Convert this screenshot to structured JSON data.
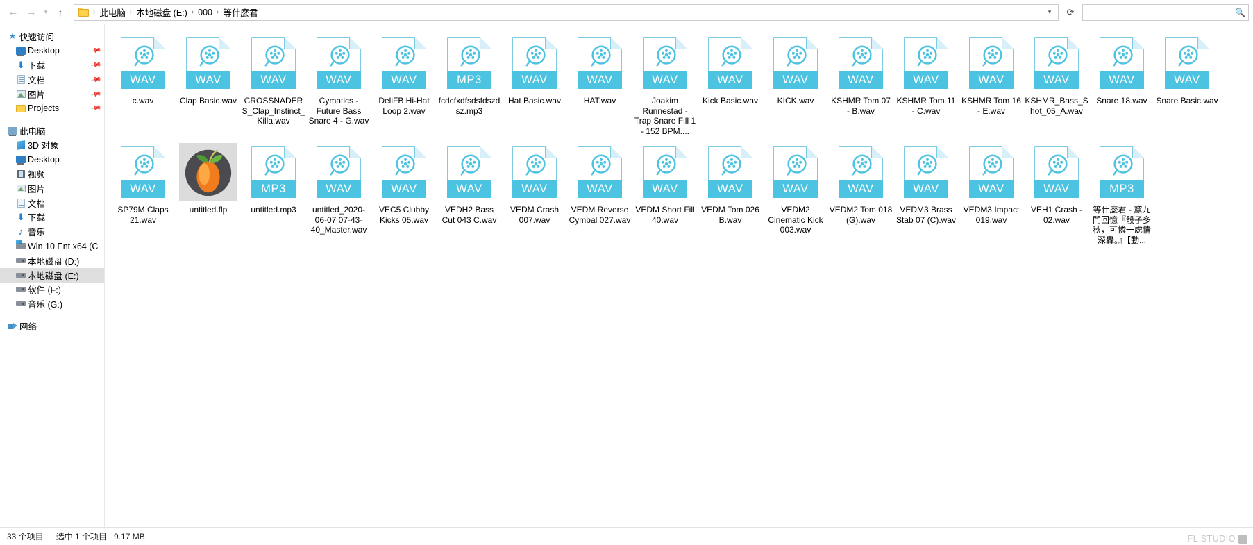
{
  "window": {
    "nav": {
      "back_icon": "arrow-left-icon",
      "forward_icon": "arrow-right-icon",
      "history_icon": "chevron-down-icon",
      "up_icon": "arrow-up-icon",
      "refresh_icon": "refresh-icon",
      "dropdown_icon": "chevron-down-icon"
    },
    "breadcrumb": [
      "此电脑",
      "本地磁盘 (E:)",
      "000",
      "等什麼君"
    ],
    "breadcrumb_separator": "›",
    "search": {
      "value": "",
      "placeholder": "",
      "icon": "search-icon"
    }
  },
  "sidebar": {
    "groups": [
      {
        "name": "快速访问",
        "icon": "star-icon",
        "items": [
          {
            "label": "Desktop",
            "icon": "monitor-icon",
            "pinned": true
          },
          {
            "label": "下载",
            "icon": "download-icon",
            "pinned": true
          },
          {
            "label": "文档",
            "icon": "document-icon",
            "pinned": true
          },
          {
            "label": "图片",
            "icon": "picture-icon",
            "pinned": true
          },
          {
            "label": "Projects",
            "icon": "folder-icon",
            "pinned": true
          }
        ]
      },
      {
        "name": "此电脑",
        "icon": "computer-icon",
        "items": [
          {
            "label": "3D 对象",
            "icon": "3d-objects-icon",
            "pinned": false
          },
          {
            "label": "Desktop",
            "icon": "monitor-icon",
            "pinned": false
          },
          {
            "label": "视频",
            "icon": "video-icon",
            "pinned": false
          },
          {
            "label": "图片",
            "icon": "picture-icon",
            "pinned": false
          },
          {
            "label": "文档",
            "icon": "document-icon",
            "pinned": false
          },
          {
            "label": "下载",
            "icon": "download-icon",
            "pinned": false
          },
          {
            "label": "音乐",
            "icon": "music-note-icon",
            "pinned": false
          },
          {
            "label": "Win 10 Ent x64 (C",
            "icon": "windows-drive-icon",
            "pinned": false
          },
          {
            "label": "本地磁盘 (D:)",
            "icon": "drive-icon",
            "pinned": false
          },
          {
            "label": "本地磁盘 (E:)",
            "icon": "drive-icon",
            "pinned": false,
            "selected": true
          },
          {
            "label": "软件 (F:)",
            "icon": "drive-icon",
            "pinned": false
          },
          {
            "label": "音乐 (G:)",
            "icon": "drive-icon",
            "pinned": false
          }
        ]
      },
      {
        "name": "网络",
        "icon": "network-icon",
        "items": []
      }
    ]
  },
  "files": [
    {
      "name": "c.wav",
      "type": "WAV",
      "icon": "wav-file-icon",
      "selected": false
    },
    {
      "name": "Clap Basic.wav",
      "type": "WAV",
      "icon": "wav-file-icon",
      "selected": false
    },
    {
      "name": "CROSSNADERS_Clap_Instinct_Killa.wav",
      "type": "WAV",
      "icon": "wav-file-icon",
      "selected": false
    },
    {
      "name": "Cymatics - Future Bass Snare 4 - G.wav",
      "type": "WAV",
      "icon": "wav-file-icon",
      "selected": false
    },
    {
      "name": "DeliFB Hi-Hat Loop 2.wav",
      "type": "WAV",
      "icon": "wav-file-icon",
      "selected": false
    },
    {
      "name": "fcdcfxdfsdsfdszdsz.mp3",
      "type": "MP3",
      "icon": "mp3-file-icon",
      "selected": false
    },
    {
      "name": "Hat Basic.wav",
      "type": "WAV",
      "icon": "wav-file-icon",
      "selected": false
    },
    {
      "name": "HAT.wav",
      "type": "WAV",
      "icon": "wav-file-icon",
      "selected": false
    },
    {
      "name": "Joakim Runnestad - Trap Snare Fill 1 - 152 BPM....",
      "type": "WAV",
      "icon": "wav-file-icon",
      "selected": false
    },
    {
      "name": "Kick Basic.wav",
      "type": "WAV",
      "icon": "wav-file-icon",
      "selected": false
    },
    {
      "name": "KICK.wav",
      "type": "WAV",
      "icon": "wav-file-icon",
      "selected": false
    },
    {
      "name": "KSHMR Tom 07 - B.wav",
      "type": "WAV",
      "icon": "wav-file-icon",
      "selected": false
    },
    {
      "name": "KSHMR Tom 11 - C.wav",
      "type": "WAV",
      "icon": "wav-file-icon",
      "selected": false
    },
    {
      "name": "KSHMR Tom 16 - E.wav",
      "type": "WAV",
      "icon": "wav-file-icon",
      "selected": false
    },
    {
      "name": "KSHMR_Bass_Shot_05_A.wav",
      "type": "WAV",
      "icon": "wav-file-icon",
      "selected": false
    },
    {
      "name": "Snare 18.wav",
      "type": "WAV",
      "icon": "wav-file-icon",
      "selected": false
    },
    {
      "name": "Snare Basic.wav",
      "type": "WAV",
      "icon": "wav-file-icon",
      "selected": false
    },
    {
      "name": "SP79M Claps 21.wav",
      "type": "WAV",
      "icon": "wav-file-icon",
      "selected": false
    },
    {
      "name": "untitled.flp",
      "type": "FLP",
      "icon": "fl-studio-icon",
      "selected": true
    },
    {
      "name": "untitled.mp3",
      "type": "MP3",
      "icon": "mp3-file-icon",
      "selected": false
    },
    {
      "name": "untitled_2020-06-07 07-43-40_Master.wav",
      "type": "WAV",
      "icon": "wav-file-icon",
      "selected": false
    },
    {
      "name": "VEC5 Clubby Kicks 05.wav",
      "type": "WAV",
      "icon": "wav-file-icon",
      "selected": false
    },
    {
      "name": "VEDH2 Bass Cut 043 C.wav",
      "type": "WAV",
      "icon": "wav-file-icon",
      "selected": false
    },
    {
      "name": "VEDM Crash 007.wav",
      "type": "WAV",
      "icon": "wav-file-icon",
      "selected": false
    },
    {
      "name": "VEDM Reverse Cymbal 027.wav",
      "type": "WAV",
      "icon": "wav-file-icon",
      "selected": false
    },
    {
      "name": "VEDM Short Fill 40.wav",
      "type": "WAV",
      "icon": "wav-file-icon",
      "selected": false
    },
    {
      "name": "VEDM Tom 026 B.wav",
      "type": "WAV",
      "icon": "wav-file-icon",
      "selected": false
    },
    {
      "name": "VEDM2 Cinematic Kick 003.wav",
      "type": "WAV",
      "icon": "wav-file-icon",
      "selected": false
    },
    {
      "name": "VEDM2 Tom 018 (G).wav",
      "type": "WAV",
      "icon": "wav-file-icon",
      "selected": false
    },
    {
      "name": "VEDM3 Brass Stab 07 (C).wav",
      "type": "WAV",
      "icon": "wav-file-icon",
      "selected": false
    },
    {
      "name": "VEDM3 Impact 019.wav",
      "type": "WAV",
      "icon": "wav-file-icon",
      "selected": false
    },
    {
      "name": "VEH1 Crash - 02.wav",
      "type": "WAV",
      "icon": "wav-file-icon",
      "selected": false
    },
    {
      "name": "等什麼君 - 黧九門回憶『骰子多秋，可憐一處情深轟。』【動...",
      "type": "MP3",
      "icon": "mp3-file-icon",
      "selected": false
    }
  ],
  "statusbar": {
    "item_count": "33 个项目",
    "selection": "选中 1 个项目",
    "size": "9.17 MB",
    "watermark": "FL STUDIO"
  },
  "colors": {
    "accent": "#4cc3e0",
    "selection": "#dcdcdc",
    "sidebar_selection": "#dedede"
  }
}
